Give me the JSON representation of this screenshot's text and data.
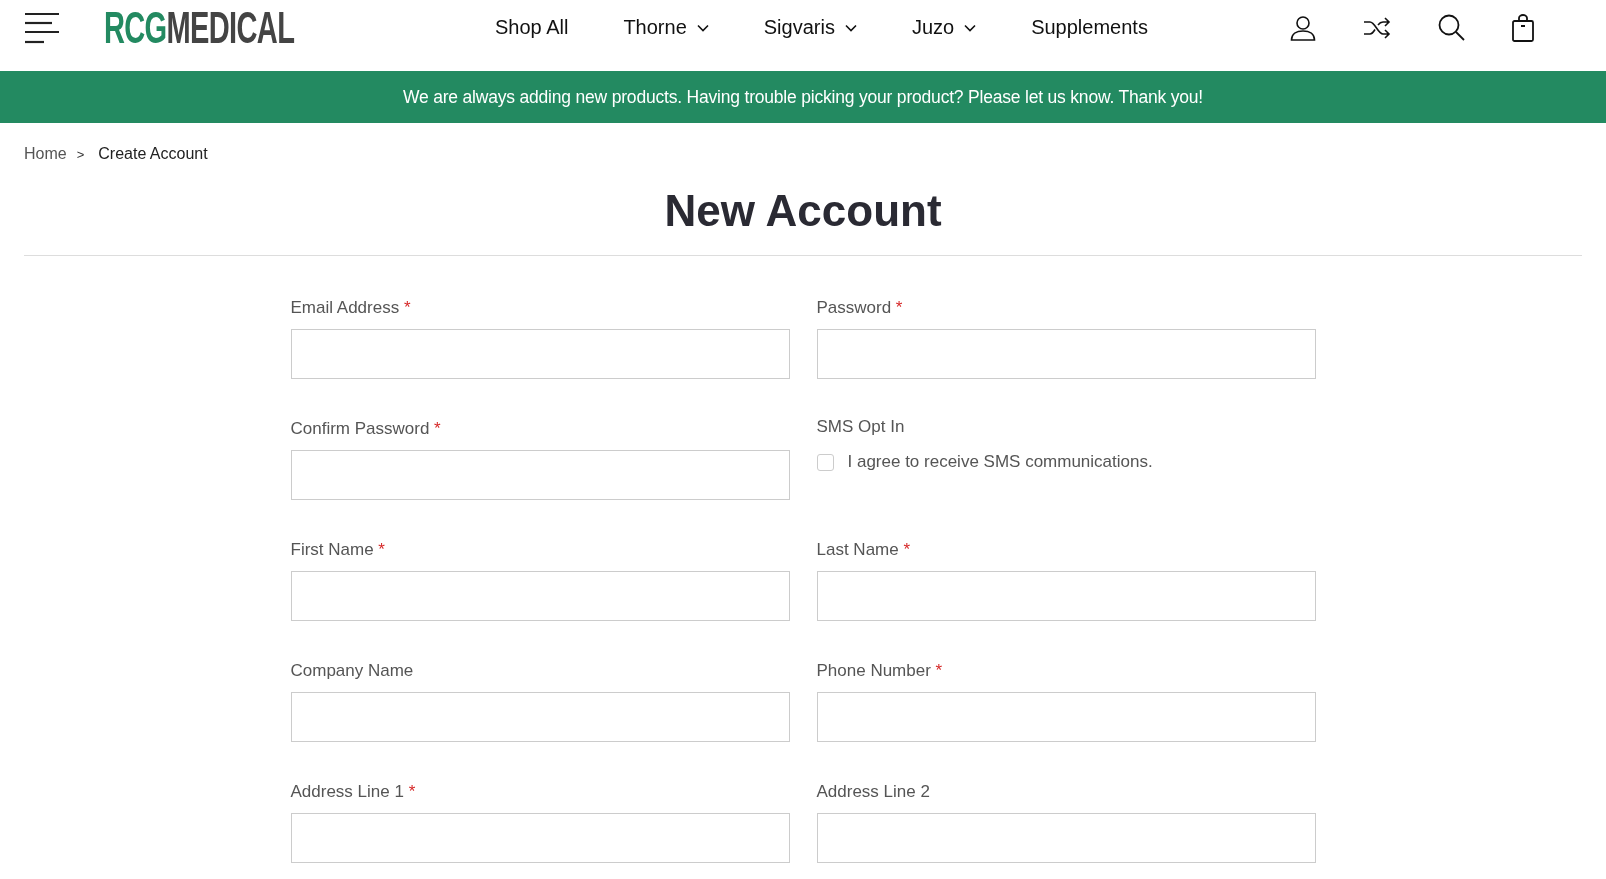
{
  "header": {
    "logo": {
      "accent": "RCG",
      "rest": "MEDICAL"
    },
    "nav": [
      {
        "label": "Shop All",
        "dropdown": false
      },
      {
        "label": "Thorne",
        "dropdown": true
      },
      {
        "label": "Sigvaris",
        "dropdown": true
      },
      {
        "label": "Juzo",
        "dropdown": true
      },
      {
        "label": "Supplements",
        "dropdown": false
      }
    ]
  },
  "banner": "We are always adding new products. Having trouble picking your product? Please let us know. Thank you!",
  "breadcrumb": [
    "Home",
    "Create Account"
  ],
  "breadcrumb_separator": ">",
  "title": "New Account",
  "fields": [
    {
      "kind": "input",
      "label": "Email Address",
      "required": true
    },
    {
      "kind": "input",
      "label": "Password",
      "required": true
    },
    {
      "kind": "input",
      "label": "Confirm Password",
      "required": true
    },
    {
      "kind": "checkbox",
      "label": "SMS Opt In",
      "required": false,
      "option": "I agree to receive SMS communications.",
      "checked": false
    },
    {
      "kind": "input",
      "label": "First Name",
      "required": true
    },
    {
      "kind": "input",
      "label": "Last Name",
      "required": true
    },
    {
      "kind": "input",
      "label": "Company Name",
      "required": false
    },
    {
      "kind": "input",
      "label": "Phone Number",
      "required": true
    },
    {
      "kind": "input",
      "label": "Address Line 1",
      "required": true
    },
    {
      "kind": "input",
      "label": "Address Line 2",
      "required": false
    }
  ],
  "required_mark": "*"
}
